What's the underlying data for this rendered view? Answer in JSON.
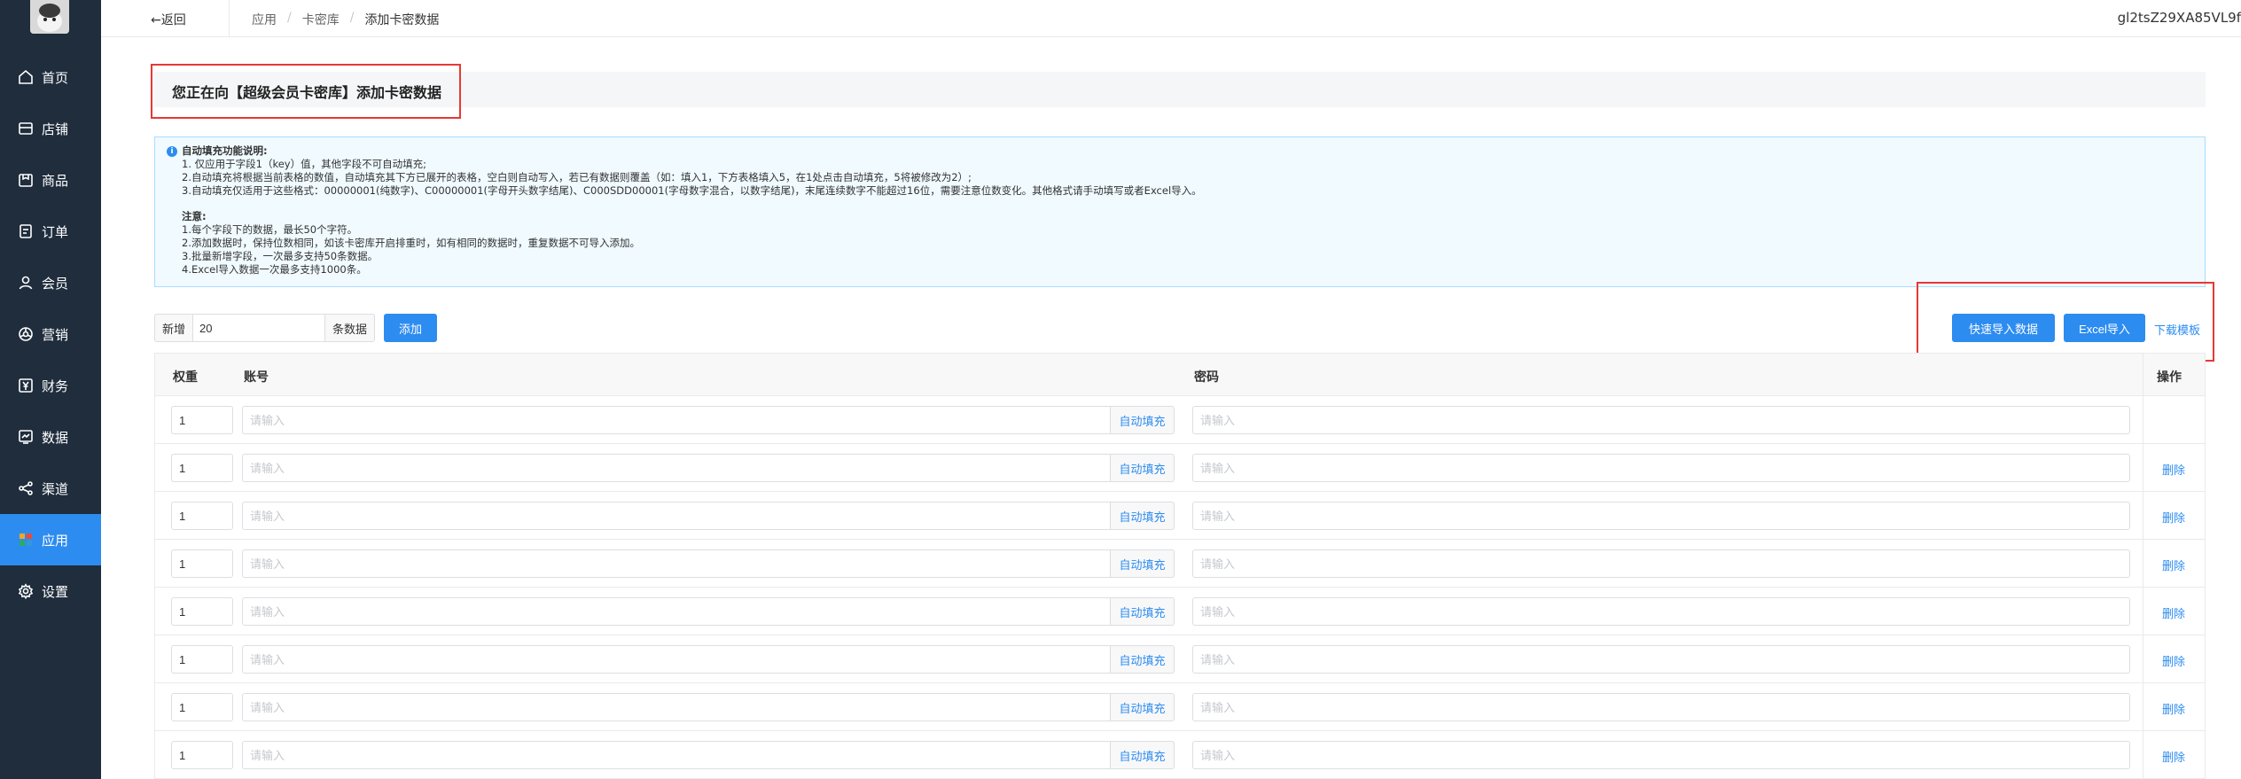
{
  "sidebar": {
    "items": [
      {
        "label": "首页",
        "icon": "home-icon",
        "active": false
      },
      {
        "label": "店铺",
        "icon": "store-icon",
        "active": false
      },
      {
        "label": "商品",
        "icon": "goods-icon",
        "active": false
      },
      {
        "label": "订单",
        "icon": "order-icon",
        "active": false
      },
      {
        "label": "会员",
        "icon": "user-icon",
        "active": false
      },
      {
        "label": "营销",
        "icon": "marketing-icon",
        "active": false
      },
      {
        "label": "财务",
        "icon": "yen-icon",
        "active": false
      },
      {
        "label": "数据",
        "icon": "data-icon",
        "active": false
      },
      {
        "label": "渠道",
        "icon": "share-icon",
        "active": false
      },
      {
        "label": "应用",
        "icon": "apps-grid-icon",
        "active": true
      },
      {
        "label": "设置",
        "icon": "gear-icon",
        "active": false
      }
    ]
  },
  "topbar": {
    "back_label": "←返回",
    "breadcrumb": [
      "应用",
      "卡密库",
      "添加卡密数据"
    ],
    "breadcrumb_sep": "/",
    "user_name": "gl2tsZ29XA85VL9f"
  },
  "page": {
    "title": "您正在向【超级会员卡密库】添加卡密数据"
  },
  "notice": {
    "heading": "自动填充功能说明:",
    "lines": [
      "1. 仅应用于字段1（key）值，其他字段不可自动填充;",
      "2.自动填充将根据当前表格的数值，自动填充其下方已展开的表格，空白则自动写入，若已有数据则覆盖（如：填入1，下方表格填入5，在1处点击自动填充，5将被修改为2）;",
      "3.自动填充仅适用于这些格式：00000001(纯数字)、C00000001(字母开头数字结尾)、C000SDD00001(字母数字混合，以数字结尾)，末尾连续数字不能超过16位，需要注意位数变化。其他格式请手动填写或者Excel导入。"
    ],
    "note_heading": "注意:",
    "notes": [
      "1.每个字段下的数据，最长50个字符。",
      "2.添加数据时，保持位数相同，如该卡密库开启排重时，如有相同的数据时，重复数据不可导入添加。",
      "3.批量新增字段，一次最多支持50条数据。",
      "4.Excel导入数据一次最多支持1000条。"
    ]
  },
  "add_bar": {
    "prefix": "新增",
    "value": "20",
    "suffix": "条数据",
    "add_label": "添加"
  },
  "actions": {
    "quick_import": "快速导入数据",
    "excel_import": "Excel导入",
    "download_template": "下载模板"
  },
  "table": {
    "headers": {
      "weight": "权重",
      "account": "账号",
      "password": "密码",
      "operation": "操作"
    },
    "placeholder": "请输入",
    "autofill_label": "自动填充",
    "delete_label": "删除",
    "rows": [
      {
        "weight": "1",
        "deletable": false
      },
      {
        "weight": "1",
        "deletable": true
      },
      {
        "weight": "1",
        "deletable": true
      },
      {
        "weight": "1",
        "deletable": true
      },
      {
        "weight": "1",
        "deletable": true
      },
      {
        "weight": "1",
        "deletable": true
      },
      {
        "weight": "1",
        "deletable": true
      },
      {
        "weight": "1",
        "deletable": true
      }
    ]
  },
  "colors": {
    "sidebar_bg": "#1f2d3d",
    "primary": "#2d8cf0",
    "highlight_box": "#e53935",
    "notice_bg": "#f0faff"
  }
}
